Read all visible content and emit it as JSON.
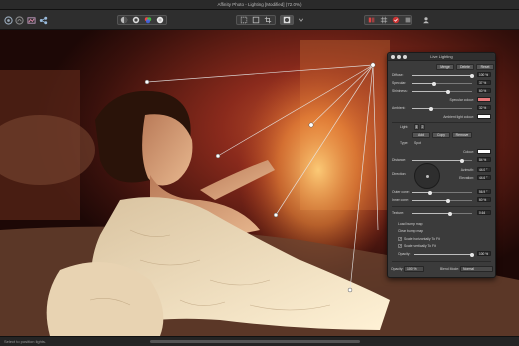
{
  "window": {
    "title": "Affinity Photo - Lighting [Modified] (72.0%)"
  },
  "toolbar": {
    "left_icons": [
      "persona-photo-icon",
      "persona-liquify-icon",
      "persona-develop-icon",
      "persona-tone-map-icon",
      "persona-export-icon"
    ],
    "right_icons": [
      "quick-mask-icon",
      "selection-icon",
      "grid-icon"
    ]
  },
  "panel": {
    "title": "Live Lighting",
    "top_buttons": [
      "Merge",
      "Delete",
      "Reset"
    ],
    "diffuse": {
      "label": "Diffuse:",
      "value": "100 %",
      "fraction": 1.0
    },
    "specular": {
      "label": "Specular:",
      "value": "37 %",
      "fraction": 0.37
    },
    "shininess": {
      "label": "Shininess:",
      "value": "60 %",
      "fraction": 0.6
    },
    "specular_colour_label": "Specular colour:",
    "ambient": {
      "label": "Ambient:",
      "value": "32 %",
      "fraction": 0.32
    },
    "ambient_light_colour_label": "Ambient light colour:",
    "light_label": "Light:",
    "light_numbers": [
      "1",
      "2"
    ],
    "light_buttons": [
      "Add",
      "Copy",
      "Remove"
    ],
    "type_label": "Type:",
    "type_value": "Spot",
    "colour_label": "Colour:",
    "distance": {
      "label": "Distance:",
      "value": "84 %",
      "fraction": 0.84
    },
    "direction_label": "Direction:",
    "azimuth": {
      "label": "Azimuth:",
      "value": "44.0 °"
    },
    "elevation": {
      "label": "Elevation:",
      "value": "44.6 °"
    },
    "outer_cone": {
      "label": "Outer cone:",
      "value": "56.9 °",
      "fraction": 0.3
    },
    "inner_cone": {
      "label": "Inner cone:",
      "value": "60 %",
      "fraction": 0.6
    },
    "texture": {
      "label": "Texture:",
      "value": "0.64",
      "fraction": 0.64
    },
    "load_bump_map": "Load bump map",
    "clear_bump_map": "Clear bump map",
    "scale_h_label": "Scale horizontally To Fit",
    "scale_v_label": "Scale vertically To Fit",
    "opacity_label": "Opacity:",
    "opacity_value": "100 %",
    "opacity_fraction": 1.0,
    "blend_mode_label": "Blend Mode:",
    "blend_mode_value": "Normal",
    "bottom_opacity_value": "100 %",
    "bottom_opacity_label": "Opacity:"
  },
  "status": {
    "hint": "Select to position lights."
  },
  "colors": {
    "specular_colour": "#e9787a",
    "ambient_light_colour": "#ffffff",
    "light_colour": "#ffffff",
    "accent": "#cfcfcf"
  }
}
